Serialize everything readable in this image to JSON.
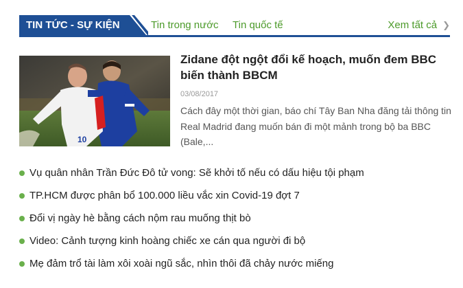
{
  "section": {
    "title": "TIN TỨC - SỰ KIỆN",
    "tabs": [
      {
        "label": "Tin trong nước"
      },
      {
        "label": "Tin quốc tế"
      }
    ],
    "see_all": "Xem tất cả",
    "accent_color": "#1e4f95",
    "link_color": "#4c9a2a"
  },
  "featured": {
    "title": "Zidane đột ngột đổi kế hoạch, muốn đem BBC biến thành BBCM",
    "date": "03/08/2017",
    "summary": "Cách đây một thời gian, báo chí Tây Ban Nha đăng tải thông tin Real Madrid đang muốn bán đi một mảnh trong bộ ba BBC (Bale,..."
  },
  "news": [
    {
      "title": "Vụ quân nhân Trần Đức Đô tử vong: Sẽ khởi tố nếu có dấu hiệu tội phạm"
    },
    {
      "title": "TP.HCM được phân bổ 100.000 liều vắc xin Covid-19 đợt 7"
    },
    {
      "title": "Đổi vị ngày hè bằng cách nộm rau muống thịt bò"
    },
    {
      "title": "Video: Cảnh tượng kinh hoàng chiếc xe cán qua người đi bộ"
    },
    {
      "title": "Mẹ đảm trổ tài làm xôi xoài ngũ sắc, nhìn thôi đã chảy nước miếng"
    }
  ]
}
